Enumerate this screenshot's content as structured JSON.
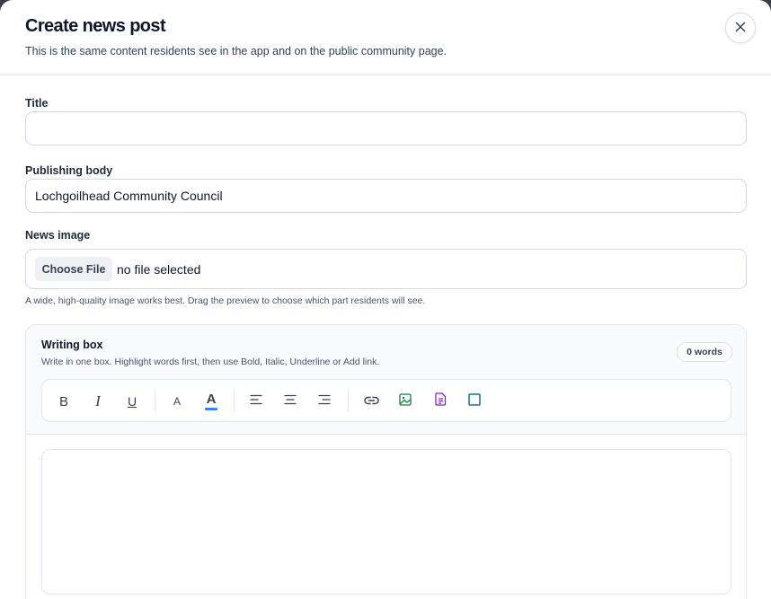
{
  "header": {
    "title": "Create news post",
    "subtitle": "This is the same content residents see in the app and on the public community page."
  },
  "fields": {
    "title": {
      "label": "Title",
      "value": "",
      "placeholder": ""
    },
    "publishing_body": {
      "label": "Publishing body",
      "value": "Lochgoilhead Community Council"
    },
    "news_image": {
      "label": "News image",
      "button_label": "Choose File",
      "status": "no file selected",
      "hint": "A wide, high-quality image works best. Drag the preview to choose which part residents will see."
    }
  },
  "writing_box": {
    "title": "Writing box",
    "subtitle": "Write in one box. Highlight words first, then use Bold, Italic, Underline or Add link.",
    "word_count": "0 words",
    "toolbar": {
      "bold": "B",
      "italic": "I",
      "underline": "U",
      "font_size": "A",
      "text_color": "A",
      "icons": [
        "align-left-icon",
        "align-center-icon",
        "align-right-icon",
        "link-icon",
        "image-icon",
        "document-icon",
        "box-icon"
      ]
    }
  },
  "colors": {
    "text_color_underline": "#3b82f6",
    "image_icon": "#15803d",
    "document_icon": "#7e22ce",
    "box_icon": "#0e7490"
  }
}
